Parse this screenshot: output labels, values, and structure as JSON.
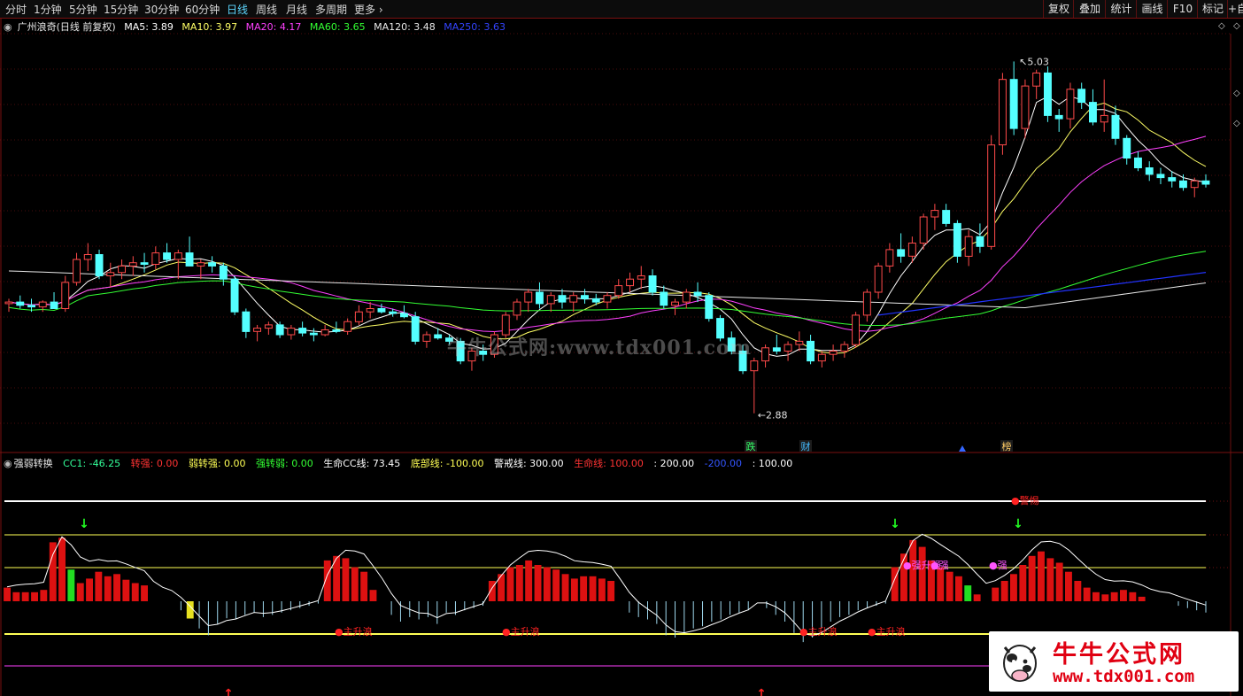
{
  "toolbar": {
    "periods": [
      "分时",
      "1分钟",
      "5分钟",
      "15分钟",
      "30分钟",
      "60分钟",
      "日线",
      "周线",
      "月线",
      "多周期",
      "更多"
    ],
    "active_period": "日线",
    "right_buttons": [
      "复权",
      "叠加",
      "统计",
      "画线",
      "F10",
      "标记",
      "+自"
    ]
  },
  "main_chart": {
    "title": "广州浪奇(日线 前复权)",
    "ma": [
      {
        "label": "MA5: 3.89",
        "color": "#ffffff"
      },
      {
        "label": "MA10: 3.97",
        "color": "#ffff66"
      },
      {
        "label": "MA20: 4.17",
        "color": "#ff40ff"
      },
      {
        "label": "MA60: 3.65",
        "color": "#33ff33"
      },
      {
        "label": "MA120: 3.48",
        "color": "#e8e8e8"
      },
      {
        "label": "MA250: 3.63",
        "color": "#3344ff"
      }
    ],
    "high_label": "5.03",
    "low_label": "2.88",
    "markers": [
      {
        "text": "跌",
        "color": "#33ff66"
      },
      {
        "text": "财",
        "color": "#44bbff"
      },
      {
        "text": "榜",
        "color": "#ffcc66"
      }
    ],
    "watermark": "牛牛公式网:www.tdx001.com"
  },
  "indicator": {
    "name": "强弱转换",
    "values": [
      {
        "label": "CC1: -46.25",
        "color": "#33ff99"
      },
      {
        "label": "转强: 0.00",
        "color": "#ff3333"
      },
      {
        "label": "弱转强: 0.00",
        "color": "#ffff55"
      },
      {
        "label": "强转弱: 0.00",
        "color": "#33ff33"
      },
      {
        "label": "生命CC线: 73.45",
        "color": "#ffffff"
      },
      {
        "label": "底部线: -100.00",
        "color": "#ffff55"
      },
      {
        "label": "警戒线: 300.00",
        "color": "#ffffff"
      },
      {
        "label": "生命线: 100.00",
        "color": "#ff3333"
      },
      {
        "label": ": 200.00",
        "color": "#ffffff"
      },
      {
        "label": "-200.00",
        "color": "#3355ff"
      },
      {
        "label": ": 100.00",
        "color": "#ffffff"
      }
    ],
    "annotations": [
      "主升浪",
      "主升浪",
      "主升浪",
      "主升浪",
      "强升强",
      "强",
      "强",
      "警惕"
    ]
  },
  "logo": {
    "cn": "牛牛公式网",
    "url": "www.tdx001.com"
  },
  "chart_data": {
    "type": "candlestick",
    "price_range": [
      2.88,
      5.03
    ],
    "candles": [
      [
        3.55,
        3.58,
        3.5,
        3.56
      ],
      [
        3.56,
        3.6,
        3.52,
        3.54
      ],
      [
        3.54,
        3.58,
        3.5,
        3.53
      ],
      [
        3.53,
        3.57,
        3.5,
        3.56
      ],
      [
        3.56,
        3.62,
        3.54,
        3.52
      ],
      [
        3.52,
        3.72,
        3.5,
        3.68
      ],
      [
        3.68,
        3.86,
        3.66,
        3.82
      ],
      [
        3.82,
        3.92,
        3.75,
        3.85
      ],
      [
        3.85,
        3.88,
        3.7,
        3.72
      ],
      [
        3.72,
        3.8,
        3.65,
        3.74
      ],
      [
        3.74,
        3.82,
        3.7,
        3.78
      ],
      [
        3.78,
        3.84,
        3.72,
        3.8
      ],
      [
        3.8,
        3.86,
        3.74,
        3.79
      ],
      [
        3.79,
        3.9,
        3.76,
        3.86
      ],
      [
        3.86,
        3.92,
        3.8,
        3.82
      ],
      [
        3.82,
        3.88,
        3.7,
        3.86
      ],
      [
        3.86,
        3.96,
        3.84,
        3.78
      ],
      [
        3.78,
        3.82,
        3.7,
        3.8
      ],
      [
        3.8,
        3.84,
        3.74,
        3.78
      ],
      [
        3.78,
        3.8,
        3.66,
        3.7
      ],
      [
        3.7,
        3.72,
        3.48,
        3.5
      ],
      [
        3.5,
        3.52,
        3.34,
        3.38
      ],
      [
        3.38,
        3.42,
        3.32,
        3.4
      ],
      [
        3.4,
        3.44,
        3.36,
        3.42
      ],
      [
        3.42,
        3.44,
        3.34,
        3.36
      ],
      [
        3.36,
        3.42,
        3.33,
        3.4
      ],
      [
        3.4,
        3.44,
        3.35,
        3.37
      ],
      [
        3.37,
        3.4,
        3.32,
        3.36
      ],
      [
        3.36,
        3.42,
        3.35,
        3.39
      ],
      [
        3.39,
        3.44,
        3.37,
        3.38
      ],
      [
        3.38,
        3.46,
        3.36,
        3.44
      ],
      [
        3.44,
        3.54,
        3.42,
        3.5
      ],
      [
        3.5,
        3.56,
        3.46,
        3.52
      ],
      [
        3.52,
        3.55,
        3.49,
        3.5
      ],
      [
        3.5,
        3.52,
        3.47,
        3.49
      ],
      [
        3.49,
        3.54,
        3.46,
        3.47
      ],
      [
        3.47,
        3.5,
        3.3,
        3.32
      ],
      [
        3.32,
        3.38,
        3.28,
        3.36
      ],
      [
        3.36,
        3.4,
        3.33,
        3.34
      ],
      [
        3.34,
        3.36,
        3.3,
        3.32
      ],
      [
        3.32,
        3.34,
        3.18,
        3.2
      ],
      [
        3.2,
        3.28,
        3.14,
        3.26
      ],
      [
        3.26,
        3.3,
        3.2,
        3.24
      ],
      [
        3.24,
        3.38,
        3.22,
        3.36
      ],
      [
        3.36,
        3.5,
        3.34,
        3.48
      ],
      [
        3.48,
        3.58,
        3.45,
        3.56
      ],
      [
        3.56,
        3.64,
        3.5,
        3.62
      ],
      [
        3.62,
        3.68,
        3.52,
        3.55
      ],
      [
        3.55,
        3.62,
        3.5,
        3.6
      ],
      [
        3.6,
        3.64,
        3.52,
        3.56
      ],
      [
        3.56,
        3.62,
        3.5,
        3.6
      ],
      [
        3.6,
        3.64,
        3.55,
        3.58
      ],
      [
        3.58,
        3.61,
        3.54,
        3.56
      ],
      [
        3.56,
        3.62,
        3.52,
        3.6
      ],
      [
        3.6,
        3.7,
        3.58,
        3.66
      ],
      [
        3.66,
        3.74,
        3.62,
        3.7
      ],
      [
        3.7,
        3.78,
        3.64,
        3.72
      ],
      [
        3.72,
        3.76,
        3.6,
        3.62
      ],
      [
        3.62,
        3.66,
        3.52,
        3.54
      ],
      [
        3.54,
        3.58,
        3.48,
        3.56
      ],
      [
        3.56,
        3.64,
        3.52,
        3.62
      ],
      [
        3.62,
        3.68,
        3.56,
        3.6
      ],
      [
        3.6,
        3.62,
        3.44,
        3.46
      ],
      [
        3.46,
        3.48,
        3.32,
        3.34
      ],
      [
        3.34,
        3.38,
        3.24,
        3.26
      ],
      [
        3.26,
        3.3,
        3.12,
        3.14
      ],
      [
        3.14,
        3.22,
        2.88,
        3.2
      ],
      [
        3.2,
        3.3,
        3.16,
        3.28
      ],
      [
        3.28,
        3.36,
        3.24,
        3.26
      ],
      [
        3.26,
        3.32,
        3.2,
        3.3
      ],
      [
        3.3,
        3.38,
        3.26,
        3.32
      ],
      [
        3.32,
        3.36,
        3.18,
        3.2
      ],
      [
        3.2,
        3.26,
        3.16,
        3.24
      ],
      [
        3.24,
        3.3,
        3.2,
        3.26
      ],
      [
        3.26,
        3.32,
        3.22,
        3.3
      ],
      [
        3.3,
        3.5,
        3.28,
        3.48
      ],
      [
        3.48,
        3.64,
        3.44,
        3.62
      ],
      [
        3.62,
        3.8,
        3.58,
        3.78
      ],
      [
        3.78,
        3.92,
        3.74,
        3.88
      ],
      [
        3.88,
        3.98,
        3.8,
        3.84
      ],
      [
        3.84,
        3.96,
        3.8,
        3.92
      ],
      [
        3.92,
        4.1,
        3.88,
        4.08
      ],
      [
        4.08,
        4.16,
        4.0,
        4.12
      ],
      [
        4.12,
        4.16,
        4.02,
        4.04
      ],
      [
        4.04,
        4.06,
        3.8,
        3.84
      ],
      [
        3.84,
        4.0,
        3.78,
        3.96
      ],
      [
        3.96,
        4.04,
        3.86,
        3.9
      ],
      [
        3.9,
        4.58,
        3.88,
        4.52
      ],
      [
        4.52,
        4.96,
        4.46,
        4.92
      ],
      [
        4.92,
        5.03,
        4.58,
        4.62
      ],
      [
        4.62,
        4.92,
        4.56,
        4.88
      ],
      [
        4.88,
        4.98,
        4.8,
        4.96
      ],
      [
        4.96,
        5.0,
        4.66,
        4.7
      ],
      [
        4.7,
        4.74,
        4.6,
        4.68
      ],
      [
        4.68,
        4.9,
        4.62,
        4.86
      ],
      [
        4.86,
        4.9,
        4.74,
        4.78
      ],
      [
        4.78,
        4.86,
        4.64,
        4.66
      ],
      [
        4.66,
        4.92,
        4.6,
        4.7
      ],
      [
        4.7,
        4.76,
        4.52,
        4.56
      ],
      [
        4.56,
        4.58,
        4.4,
        4.44
      ],
      [
        4.44,
        4.48,
        4.36,
        4.38
      ],
      [
        4.38,
        4.42,
        4.3,
        4.34
      ],
      [
        4.34,
        4.38,
        4.28,
        4.32
      ],
      [
        4.32,
        4.36,
        4.26,
        4.3
      ],
      [
        4.3,
        4.34,
        4.24,
        4.26
      ],
      [
        4.26,
        4.32,
        4.2,
        4.3
      ],
      [
        4.3,
        4.34,
        4.26,
        4.28
      ]
    ],
    "ind_bars": [
      120,
      80,
      80,
      80,
      100,
      520,
      560,
      280,
      160,
      200,
      260,
      220,
      240,
      190,
      160,
      140,
      0,
      0,
      0,
      -80,
      -160,
      -240,
      -300,
      -200,
      -150,
      -160,
      -120,
      -100,
      -140,
      -120,
      -100,
      -80,
      -60,
      -40,
      -20,
      360,
      400,
      380,
      300,
      260,
      100,
      0,
      -120,
      -180,
      -140,
      -160,
      -140,
      -200,
      -100,
      -120,
      -80,
      -60,
      -40,
      180,
      240,
      300,
      320,
      360,
      320,
      300,
      280,
      240,
      200,
      220,
      220,
      200,
      180,
      0,
      -100,
      -140,
      -160,
      -200,
      -300,
      -320,
      -280,
      -240,
      -220,
      -180,
      -160,
      -120,
      -100,
      -80,
      0,
      -60,
      -120,
      -180,
      -280,
      -360,
      -320,
      -240,
      -180,
      -140,
      -120,
      -80,
      -60,
      -40,
      -20,
      300,
      420,
      540,
      480,
      360,
      300,
      260,
      220,
      140,
      60,
      0,
      120,
      180,
      240,
      320,
      400,
      440,
      380,
      340,
      260,
      180,
      120,
      80,
      60,
      80,
      100,
      80,
      40,
      0,
      0,
      0,
      -40,
      -60,
      -80,
      -100
    ]
  }
}
